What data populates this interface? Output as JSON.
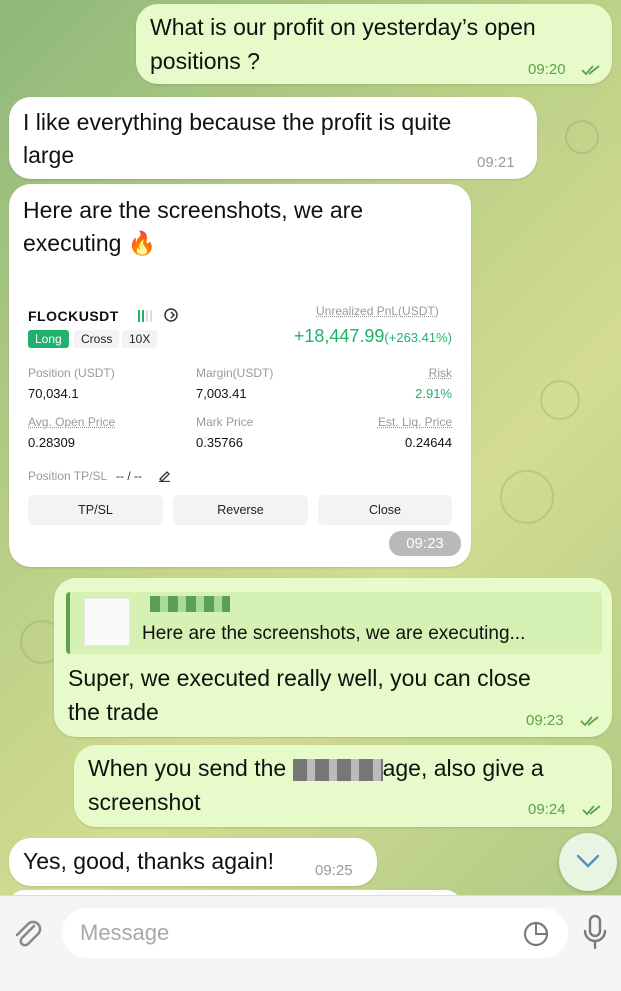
{
  "messages": {
    "m1": {
      "text_line1": "What is our profit on yesterday’s open",
      "text_line2": "positions ?",
      "time": "09:20"
    },
    "m2": {
      "text_line1": "I like everything because the profit is quite",
      "text_line2": "large",
      "time": "09:21"
    },
    "m3": {
      "text_line1": "Here are the screenshots, we are",
      "text_line2": "executing",
      "emoji": "🔥",
      "time": "09:23"
    },
    "m4": {
      "reply_quote": "Here are the screenshots, we are executing...",
      "text_line1": "Super, we executed really well, you can close",
      "text_line2": "the trade",
      "time": "09:23"
    },
    "m5": {
      "text_line1_a": "When you send the",
      "text_line1_b": "age, also give a",
      "text_line2": "screenshot",
      "time": "09:24"
    },
    "m6": {
      "text": "Yes, good, thanks again!",
      "time": "09:25"
    }
  },
  "trade_card": {
    "symbol": "FLOCKUSDT",
    "side": "Long",
    "mode": "Cross",
    "leverage": "10X",
    "pnl_label": "Unrealized PnL(USDT)",
    "pnl_value": "+18,447.99",
    "pnl_pct": "(+263.41%)",
    "position_label": "Position (USDT)",
    "position_value": "70,034.1",
    "margin_label": "Margin(USDT)",
    "margin_value": "7,003.41",
    "risk_label": "Risk",
    "risk_value": "2.91%",
    "avg_label": "Avg. Open Price",
    "avg_value": "0.28309",
    "mark_label": "Mark Price",
    "mark_value": "0.35766",
    "liq_label": "Est. Liq. Price",
    "liq_value": "0.24644",
    "tpsl_label": "Position TP/SL",
    "tpsl_value": "-- / --",
    "btn_tpsl": "TP/SL",
    "btn_reverse": "Reverse",
    "btn_close": "Close"
  },
  "input": {
    "placeholder": "Message"
  },
  "colors": {
    "outgoing": "#e6fbc9",
    "incoming": "#ffffff",
    "accent": "#5fa24b",
    "pnl_green": "#20b26c",
    "long_tag": "#20b26c"
  },
  "icons": [
    "attach-icon",
    "sticker-icon",
    "microphone-icon",
    "scroll-down-icon",
    "double-check-icon",
    "fire-emoji",
    "edit-icon",
    "share-icon"
  ]
}
